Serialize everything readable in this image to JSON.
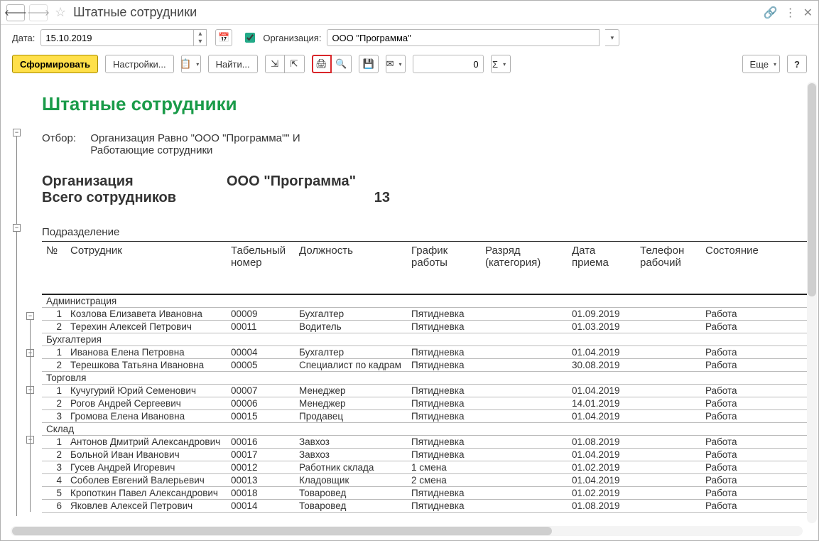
{
  "title": "Штатные сотрудники",
  "filter": {
    "date_label": "Дата:",
    "date_value": "15.10.2019",
    "org_checkbox_label": "Организация:",
    "org_value": "ООО \"Программа\""
  },
  "toolbar": {
    "form": "Сформировать",
    "settings": "Настройки...",
    "find": "Найти...",
    "num_value": "0",
    "more": "Еще",
    "help": "?"
  },
  "report": {
    "title": "Штатные сотрудники",
    "filter_label": "Отбор:",
    "filter_line1": "Организация Равно \"ООО \"Программа\"\" И",
    "filter_line2": "Работающие сотрудники",
    "org_label": "Организация",
    "org_value": "ООО \"Программа\"",
    "total_label": "Всего сотрудников",
    "total_value": "13",
    "subdiv_label": "Подразделение",
    "columns": [
      "№",
      "Сотрудник",
      "Табельный номер",
      "Должность",
      "График работы",
      "Разряд (категория)",
      "Дата приема",
      "Телефон рабочий",
      "Состояние"
    ],
    "groups": [
      {
        "name": "Администрация",
        "rows": [
          {
            "n": "1",
            "emp": "Козлова Елизавета Ивановна",
            "tab": "00009",
            "pos": "Бухгалтер",
            "sched": "Пятидневка",
            "rank": "",
            "hired": "01.09.2019",
            "phone": "",
            "state": "Работа"
          },
          {
            "n": "2",
            "emp": "Терехин Алексей Петрович",
            "tab": "00011",
            "pos": "Водитель",
            "sched": "Пятидневка",
            "rank": "",
            "hired": "01.03.2019",
            "phone": "",
            "state": "Работа"
          }
        ]
      },
      {
        "name": "Бухгалтерия",
        "rows": [
          {
            "n": "1",
            "emp": "Иванова Елена Петровна",
            "tab": "00004",
            "pos": "Бухгалтер",
            "sched": "Пятидневка",
            "rank": "",
            "hired": "01.04.2019",
            "phone": "",
            "state": "Работа"
          },
          {
            "n": "2",
            "emp": "Терешкова Татьяна Ивановна",
            "tab": "00005",
            "pos": "Специалист по кадрам",
            "sched": "Пятидневка",
            "rank": "",
            "hired": "30.08.2019",
            "phone": "",
            "state": "Работа"
          }
        ]
      },
      {
        "name": "Торговля",
        "rows": [
          {
            "n": "1",
            "emp": "Кучугурий Юрий Семенович",
            "tab": "00007",
            "pos": "Менеджер",
            "sched": "Пятидневка",
            "rank": "",
            "hired": "01.04.2019",
            "phone": "",
            "state": "Работа"
          },
          {
            "n": "2",
            "emp": "Рогов Андрей Сергеевич",
            "tab": "00006",
            "pos": "Менеджер",
            "sched": "Пятидневка",
            "rank": "",
            "hired": "14.01.2019",
            "phone": "",
            "state": "Работа"
          },
          {
            "n": "3",
            "emp": "Громова Елена Ивановна",
            "tab": "00015",
            "pos": "Продавец",
            "sched": "Пятидневка",
            "rank": "",
            "hired": "01.04.2019",
            "phone": "",
            "state": "Работа"
          }
        ]
      },
      {
        "name": "Склад",
        "rows": [
          {
            "n": "1",
            "emp": "Антонов Дмитрий Александрович",
            "tab": "00016",
            "pos": "Завхоз",
            "sched": "Пятидневка",
            "rank": "",
            "hired": "01.08.2019",
            "phone": "",
            "state": "Работа"
          },
          {
            "n": "2",
            "emp": "Больной Иван Иванович",
            "tab": "00017",
            "pos": "Завхоз",
            "sched": "Пятидневка",
            "rank": "",
            "hired": "01.04.2019",
            "phone": "",
            "state": "Работа"
          },
          {
            "n": "3",
            "emp": "Гусев Андрей Игоревич",
            "tab": "00012",
            "pos": "Работник склада",
            "sched": "1 смена",
            "rank": "",
            "hired": "01.02.2019",
            "phone": "",
            "state": "Работа"
          },
          {
            "n": "4",
            "emp": "Соболев Евгений Валерьевич",
            "tab": "00013",
            "pos": "Кладовщик",
            "sched": "2 смена",
            "rank": "",
            "hired": "01.04.2019",
            "phone": "",
            "state": "Работа"
          },
          {
            "n": "5",
            "emp": "Кропоткин Павел Александрович",
            "tab": "00018",
            "pos": "Товаровед",
            "sched": "Пятидневка",
            "rank": "",
            "hired": "01.02.2019",
            "phone": "",
            "state": "Работа"
          },
          {
            "n": "6",
            "emp": "Яковлев Алексей Петрович",
            "tab": "00014",
            "pos": "Товаровед",
            "sched": "Пятидневка",
            "rank": "",
            "hired": "01.08.2019",
            "phone": "",
            "state": "Работа"
          }
        ]
      }
    ]
  }
}
